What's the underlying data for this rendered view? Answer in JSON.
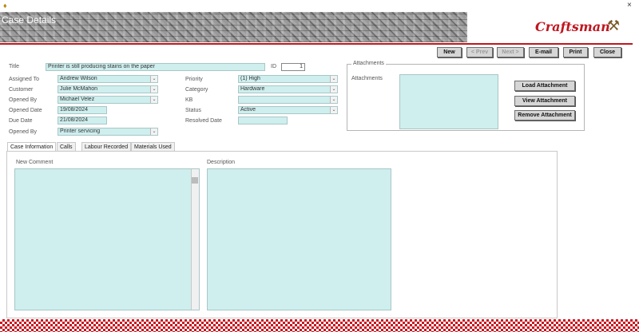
{
  "window": {
    "app_icon": "app-icon",
    "close_glyph": "×"
  },
  "header": {
    "title": "Case Details",
    "brand": "Craftsman",
    "brand_icon": "⚒"
  },
  "toolbar": {
    "new": "New",
    "prev": "< Prev",
    "next": "Next >",
    "email": "E-mail",
    "print": "Print",
    "close": "Close"
  },
  "form": {
    "title_label": "Title",
    "title_value": "Printer is still producing stains on the paper",
    "id_label": "ID",
    "id_value": "1",
    "assigned_to_label": "Assigned To",
    "assigned_to_value": "Andrew Wilson",
    "customer_label": "Customer",
    "customer_value": "Julie McMahon",
    "opened_by_label": "Opened By",
    "opened_by_value": "Michael Velez",
    "opened_date_label": "Opened Date",
    "opened_date_value": "19/08/2024",
    "due_date_label": "Due Date",
    "due_date_value": "21/08/2024",
    "opened_by2_label": "Opened By",
    "opened_by2_value": "Printer servicing",
    "priority_label": "Priority",
    "priority_value": "(1) High",
    "category_label": "Category",
    "category_value": "Hardware",
    "kb_label": "KB",
    "kb_value": "",
    "status_label": "Status",
    "status_value": "Active",
    "resolved_date_label": "Resolved Date",
    "resolved_date_value": ""
  },
  "attachments": {
    "legend": "Attachments",
    "label": "Attachments",
    "load": "Load Attachment",
    "view": "View Attachment",
    "remove": "Remove Attachment"
  },
  "tabs": [
    {
      "label": "Case Information"
    },
    {
      "label": "Calls"
    },
    {
      "label": "Labour Recorded"
    },
    {
      "label": "Materials Used"
    }
  ],
  "panel": {
    "new_comment_label": "New Comment",
    "description_label": "Description"
  },
  "colors": {
    "accent_red": "#c0161f",
    "field_bg": "#cfeeee"
  }
}
